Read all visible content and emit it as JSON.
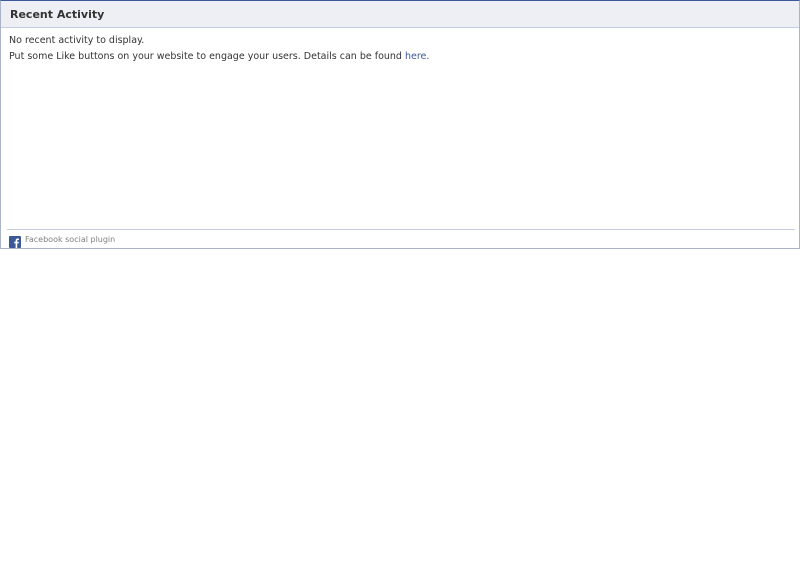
{
  "widget": {
    "title": "Recent Activity",
    "message_line1": "No recent activity to display.",
    "message_line2_prefix": "Put some Like buttons on your website to engage your users. Details can be found ",
    "message_line2_link": "here",
    "message_line2_suffix": ".",
    "footer_label": "Facebook social plugin",
    "footer_icon": "facebook-icon"
  },
  "colors": {
    "header_bg": "#edeff4",
    "border_top": "#3b5998",
    "link": "#3b5998",
    "text": "#333333",
    "footer_text": "#808080"
  }
}
